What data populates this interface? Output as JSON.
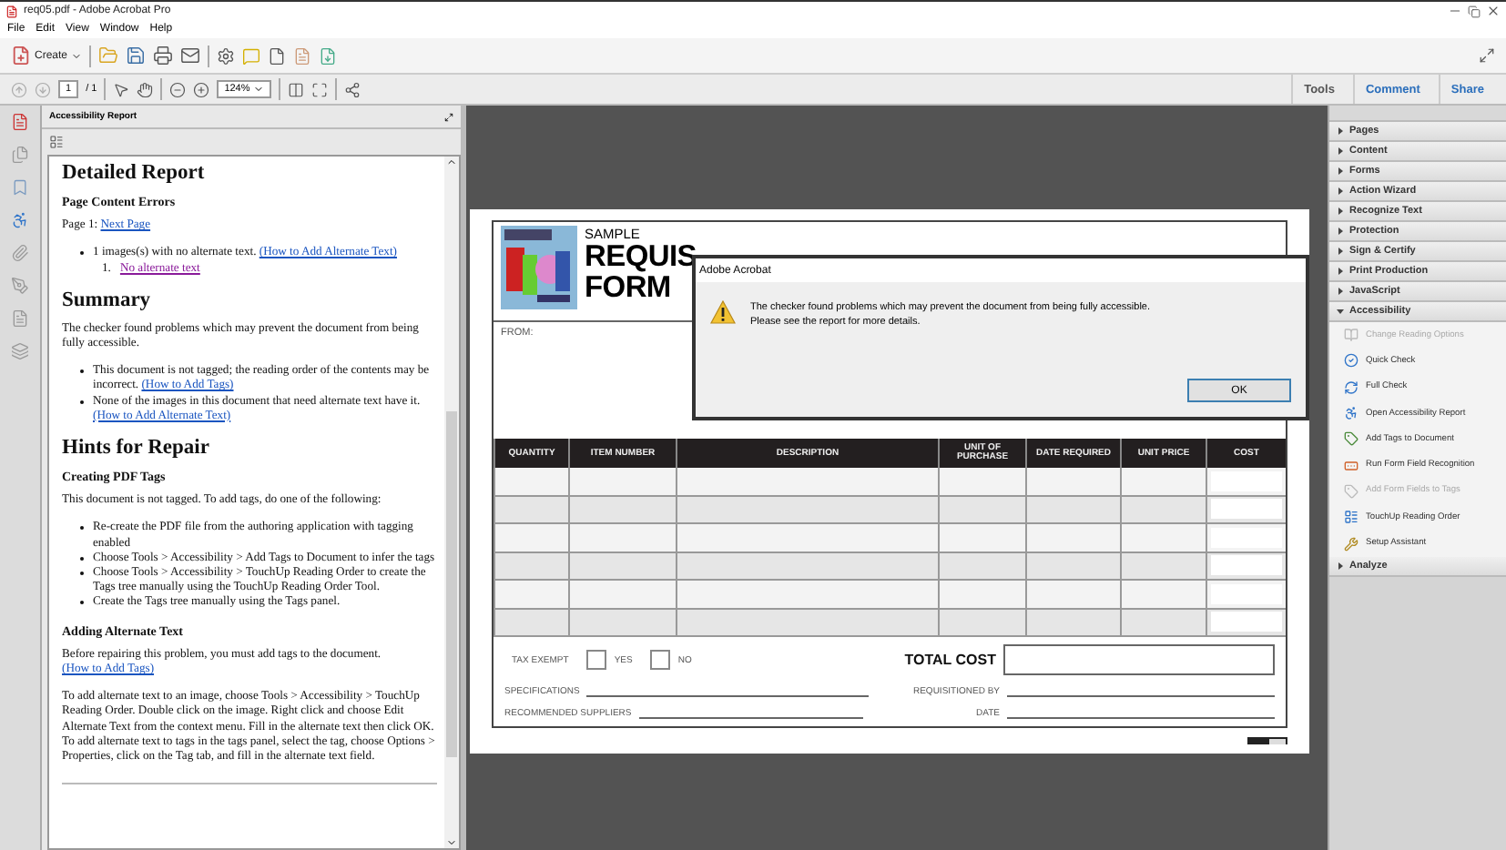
{
  "window": {
    "title": "req05.pdf - Adobe Acrobat Pro"
  },
  "menu": [
    "File",
    "Edit",
    "View",
    "Window",
    "Help"
  ],
  "toolbar": {
    "create": "Create"
  },
  "nav": {
    "page": "1",
    "page_count": "/ 1",
    "zoom": "124%"
  },
  "task_tabs": [
    {
      "label": "Tools",
      "selected": true
    },
    {
      "label": "Comment",
      "selected": false
    },
    {
      "label": "Share",
      "selected": false
    }
  ],
  "report": {
    "title": "Accessibility Report",
    "blocks": [
      {
        "kind": "h1",
        "text": "Detailed Report"
      },
      {
        "kind": "h2",
        "text": "Page Content Errors"
      },
      {
        "kind": "p",
        "segments": [
          {
            "kind": "text",
            "text": "Page 1: "
          },
          {
            "kind": "link",
            "text": "Next Page"
          }
        ]
      },
      {
        "kind": "bullets",
        "items": [
          {
            "segments": [
              {
                "kind": "text",
                "text": "1 images(s) with no alternate text. "
              },
              {
                "kind": "link",
                "text": "(How to Add Alternate Text)"
              }
            ],
            "children": [
              {
                "marker": "1.",
                "segments": [
                  {
                    "kind": "visited",
                    "text": "No alternate text"
                  }
                ]
              }
            ]
          }
        ]
      },
      {
        "kind": "h1",
        "text": "Summary"
      },
      {
        "kind": "p",
        "segments": [
          {
            "kind": "text",
            "text": "The checker found problems which may prevent the document from being fully accessible."
          }
        ]
      },
      {
        "kind": "bullets",
        "items": [
          {
            "segments": [
              {
                "kind": "text",
                "text": "This document is not tagged; the reading order of the contents may be incorrect. "
              },
              {
                "kind": "link",
                "text": "(How to Add Tags)"
              }
            ]
          },
          {
            "segments": [
              {
                "kind": "text",
                "text": "None of the images in this document that need alternate text have it. "
              },
              {
                "kind": "link",
                "text": "(How to Add Alternate Text)"
              }
            ]
          }
        ]
      },
      {
        "kind": "h1",
        "text": "Hints for Repair"
      },
      {
        "kind": "h2",
        "text": "Creating PDF Tags"
      },
      {
        "kind": "p",
        "segments": [
          {
            "kind": "text",
            "text": "This document is not tagged. To add tags, do one of the following:"
          }
        ]
      },
      {
        "kind": "bullets",
        "items": [
          {
            "segments": [
              {
                "kind": "text",
                "text": "Re-create the PDF file from the authoring application with tagging enabled"
              }
            ]
          },
          {
            "segments": [
              {
                "kind": "text",
                "text": "Choose Tools > Accessibility > Add Tags to Document to infer the tags"
              }
            ]
          },
          {
            "segments": [
              {
                "kind": "text",
                "text": "Choose Tools > Accessibility > TouchUp Reading Order to create the Tags tree manually using the TouchUp Reading Order Tool."
              }
            ]
          },
          {
            "segments": [
              {
                "kind": "text",
                "text": "Create the Tags tree manually using the Tags panel."
              }
            ]
          }
        ]
      },
      {
        "kind": "h2",
        "text": "Adding Alternate Text"
      },
      {
        "kind": "p",
        "segments": [
          {
            "kind": "text",
            "text": "Before repairing this problem, you must add tags to the document. "
          },
          {
            "kind": "link",
            "text": "(How to Add Tags)"
          }
        ]
      },
      {
        "kind": "p",
        "segments": [
          {
            "kind": "text",
            "text": "To add alternate text to an image, choose Tools > Accessibility > TouchUp Reading Order. Double click on the image. Right click and choose Edit Alternate Text from the context menu. Fill in the alternate text then click OK. To add alternate text to tags in the tags panel, select the tag, choose Options > Properties, click on the Tag tab, and fill in the alternate text field."
          }
        ]
      },
      {
        "kind": "rule"
      }
    ]
  },
  "form": {
    "sample": "SAMPLE",
    "title_line_1": "REQUIS",
    "title_line_2": "FORM",
    "from": "FROM:",
    "columns": [
      "QUANTITY",
      "ITEM NUMBER",
      "DESCRIPTION",
      "UNIT OF PURCHASE",
      "DATE REQUIRED",
      "UNIT PRICE",
      "COST"
    ],
    "row_count_rows": [
      {},
      {},
      {},
      {},
      {},
      {}
    ],
    "tax_exempt": "TAX EXEMPT",
    "options": [
      {
        "label": "YES",
        "checked": false
      },
      {
        "label": "NO",
        "checked": false
      }
    ],
    "total_cost": "TOTAL COST",
    "lines": [
      "SPECIFICATIONS",
      "REQUISITIONED BY",
      "RECOMMENDED SUPPLIERS",
      "DATE"
    ]
  },
  "dialog": {
    "title": "Adobe Acrobat",
    "message": [
      "The checker found problems which may prevent the document from being fully accessible.",
      "Please see the report for more details."
    ],
    "button": "OK"
  },
  "tools_panel": {
    "sections": [
      {
        "label": "Pages",
        "expanded": false
      },
      {
        "label": "Content",
        "expanded": false
      },
      {
        "label": "Forms",
        "expanded": false
      },
      {
        "label": "Action Wizard",
        "expanded": false
      },
      {
        "label": "Recognize Text",
        "expanded": false
      },
      {
        "label": "Protection",
        "expanded": false
      },
      {
        "label": "Sign & Certify",
        "expanded": false
      },
      {
        "label": "Print Production",
        "expanded": false
      },
      {
        "label": "JavaScript",
        "expanded": false
      },
      {
        "label": "Accessibility",
        "expanded": true,
        "items": [
          {
            "label": "Change Reading Options",
            "disabled": true
          },
          {
            "label": "Quick Check",
            "disabled": false
          },
          {
            "label": "Full Check",
            "disabled": false
          },
          {
            "label": "Open Accessibility Report",
            "disabled": false
          },
          {
            "label": "Add Tags to Document",
            "disabled": false
          },
          {
            "label": "Run Form Field Recognition",
            "disabled": false
          },
          {
            "label": "Add Form Fields to Tags",
            "disabled": true
          },
          {
            "label": "TouchUp Reading Order",
            "disabled": false
          },
          {
            "label": "Setup Assistant",
            "disabled": false
          }
        ]
      },
      {
        "label": "Analyze",
        "expanded": false
      }
    ]
  }
}
